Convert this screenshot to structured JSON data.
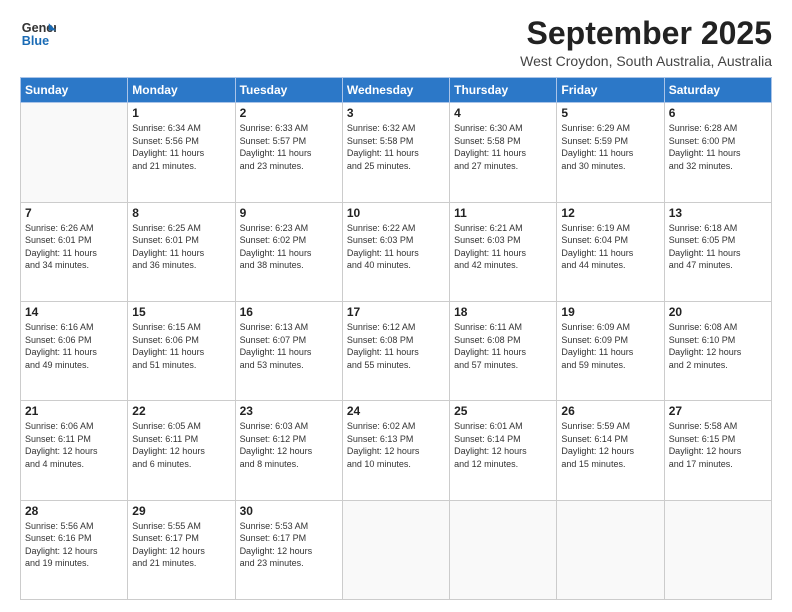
{
  "logo": {
    "general": "General",
    "blue": "Blue"
  },
  "title": "September 2025",
  "location": "West Croydon, South Australia, Australia",
  "days_header": [
    "Sunday",
    "Monday",
    "Tuesday",
    "Wednesday",
    "Thursday",
    "Friday",
    "Saturday"
  ],
  "weeks": [
    [
      {
        "day": "",
        "info": ""
      },
      {
        "day": "1",
        "info": "Sunrise: 6:34 AM\nSunset: 5:56 PM\nDaylight: 11 hours\nand 21 minutes."
      },
      {
        "day": "2",
        "info": "Sunrise: 6:33 AM\nSunset: 5:57 PM\nDaylight: 11 hours\nand 23 minutes."
      },
      {
        "day": "3",
        "info": "Sunrise: 6:32 AM\nSunset: 5:58 PM\nDaylight: 11 hours\nand 25 minutes."
      },
      {
        "day": "4",
        "info": "Sunrise: 6:30 AM\nSunset: 5:58 PM\nDaylight: 11 hours\nand 27 minutes."
      },
      {
        "day": "5",
        "info": "Sunrise: 6:29 AM\nSunset: 5:59 PM\nDaylight: 11 hours\nand 30 minutes."
      },
      {
        "day": "6",
        "info": "Sunrise: 6:28 AM\nSunset: 6:00 PM\nDaylight: 11 hours\nand 32 minutes."
      }
    ],
    [
      {
        "day": "7",
        "info": "Sunrise: 6:26 AM\nSunset: 6:01 PM\nDaylight: 11 hours\nand 34 minutes."
      },
      {
        "day": "8",
        "info": "Sunrise: 6:25 AM\nSunset: 6:01 PM\nDaylight: 11 hours\nand 36 minutes."
      },
      {
        "day": "9",
        "info": "Sunrise: 6:23 AM\nSunset: 6:02 PM\nDaylight: 11 hours\nand 38 minutes."
      },
      {
        "day": "10",
        "info": "Sunrise: 6:22 AM\nSunset: 6:03 PM\nDaylight: 11 hours\nand 40 minutes."
      },
      {
        "day": "11",
        "info": "Sunrise: 6:21 AM\nSunset: 6:03 PM\nDaylight: 11 hours\nand 42 minutes."
      },
      {
        "day": "12",
        "info": "Sunrise: 6:19 AM\nSunset: 6:04 PM\nDaylight: 11 hours\nand 44 minutes."
      },
      {
        "day": "13",
        "info": "Sunrise: 6:18 AM\nSunset: 6:05 PM\nDaylight: 11 hours\nand 47 minutes."
      }
    ],
    [
      {
        "day": "14",
        "info": "Sunrise: 6:16 AM\nSunset: 6:06 PM\nDaylight: 11 hours\nand 49 minutes."
      },
      {
        "day": "15",
        "info": "Sunrise: 6:15 AM\nSunset: 6:06 PM\nDaylight: 11 hours\nand 51 minutes."
      },
      {
        "day": "16",
        "info": "Sunrise: 6:13 AM\nSunset: 6:07 PM\nDaylight: 11 hours\nand 53 minutes."
      },
      {
        "day": "17",
        "info": "Sunrise: 6:12 AM\nSunset: 6:08 PM\nDaylight: 11 hours\nand 55 minutes."
      },
      {
        "day": "18",
        "info": "Sunrise: 6:11 AM\nSunset: 6:08 PM\nDaylight: 11 hours\nand 57 minutes."
      },
      {
        "day": "19",
        "info": "Sunrise: 6:09 AM\nSunset: 6:09 PM\nDaylight: 11 hours\nand 59 minutes."
      },
      {
        "day": "20",
        "info": "Sunrise: 6:08 AM\nSunset: 6:10 PM\nDaylight: 12 hours\nand 2 minutes."
      }
    ],
    [
      {
        "day": "21",
        "info": "Sunrise: 6:06 AM\nSunset: 6:11 PM\nDaylight: 12 hours\nand 4 minutes."
      },
      {
        "day": "22",
        "info": "Sunrise: 6:05 AM\nSunset: 6:11 PM\nDaylight: 12 hours\nand 6 minutes."
      },
      {
        "day": "23",
        "info": "Sunrise: 6:03 AM\nSunset: 6:12 PM\nDaylight: 12 hours\nand 8 minutes."
      },
      {
        "day": "24",
        "info": "Sunrise: 6:02 AM\nSunset: 6:13 PM\nDaylight: 12 hours\nand 10 minutes."
      },
      {
        "day": "25",
        "info": "Sunrise: 6:01 AM\nSunset: 6:14 PM\nDaylight: 12 hours\nand 12 minutes."
      },
      {
        "day": "26",
        "info": "Sunrise: 5:59 AM\nSunset: 6:14 PM\nDaylight: 12 hours\nand 15 minutes."
      },
      {
        "day": "27",
        "info": "Sunrise: 5:58 AM\nSunset: 6:15 PM\nDaylight: 12 hours\nand 17 minutes."
      }
    ],
    [
      {
        "day": "28",
        "info": "Sunrise: 5:56 AM\nSunset: 6:16 PM\nDaylight: 12 hours\nand 19 minutes."
      },
      {
        "day": "29",
        "info": "Sunrise: 5:55 AM\nSunset: 6:17 PM\nDaylight: 12 hours\nand 21 minutes."
      },
      {
        "day": "30",
        "info": "Sunrise: 5:53 AM\nSunset: 6:17 PM\nDaylight: 12 hours\nand 23 minutes."
      },
      {
        "day": "",
        "info": ""
      },
      {
        "day": "",
        "info": ""
      },
      {
        "day": "",
        "info": ""
      },
      {
        "day": "",
        "info": ""
      }
    ]
  ]
}
